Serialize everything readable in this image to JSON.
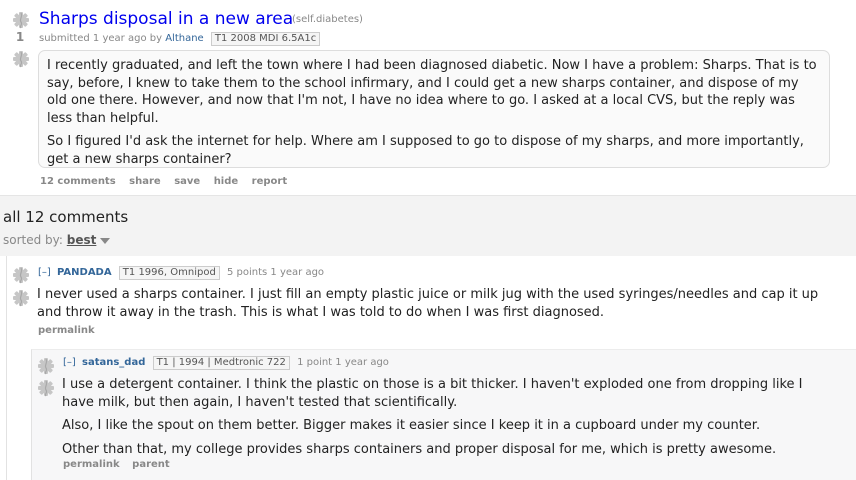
{
  "post": {
    "title": "Sharps disposal in a new area",
    "domain": "(self.diabetes)",
    "score": "1",
    "submitted_prefix": "submitted 1 year ago by",
    "author": "Althane",
    "flair": "T1 2008 MDI 6.5A1c",
    "selftext": [
      "I recently graduated, and left the town where I had been diagnosed diabetic. Now I have a problem: Sharps. That is to say, before, I knew to take them to the school infirmary, and I could get a new sharps container, and dispose of my old one there. However, and now that I'm not, I have no idea where to go. I asked at a local CVS, but the reply was less than helpful.",
      "So I figured I'd ask the internet for help. Where am I supposed to go to dispose of my sharps, and more importantly, get a new sharps container?"
    ],
    "buttons": [
      "12 comments",
      "share",
      "save",
      "hide",
      "report"
    ]
  },
  "comments_area": {
    "heading": "all 12 comments",
    "sorted_by_label": "sorted by:",
    "sort_value": "best"
  },
  "comments": [
    {
      "toggle": "[–]",
      "author": "PANDADA",
      "flair": "T1 1996, Omnipod",
      "points": "5 points 1 year ago",
      "body": [
        "I never used a sharps container. I just fill an empty plastic juice or milk jug with the used syringes/needles and cap it up and throw it away in the trash. This is what I was told to do when I was first diagnosed."
      ],
      "buttons": [
        "permalink"
      ]
    },
    {
      "toggle": "[–]",
      "author": "satans_dad",
      "flair": "T1 | 1994 | Medtronic 722",
      "points": "1 point 1 year ago",
      "body": [
        "I use a detergent container. I think the plastic on those is a bit thicker. I haven't exploded one from dropping like I have milk, but then again, I haven't tested that scientifically.",
        "Also, I like the spout on them better. Bigger makes it easier since I keep it in a cupboard under my counter.",
        "Other than that, my college provides sharps containers and proper disposal for me, which is pretty awesome."
      ],
      "buttons": [
        "permalink",
        "parent"
      ]
    }
  ],
  "colors": {
    "link_blue": "#0000ee",
    "author_blue": "#369",
    "muted_gray": "#888",
    "selftext_bg": "#fafafa",
    "panel_gray": "#f3f3f3"
  },
  "icons": {
    "vote": "caduceus-star-of-life-icon",
    "sort_dropdown": "triangle-down-icon"
  }
}
